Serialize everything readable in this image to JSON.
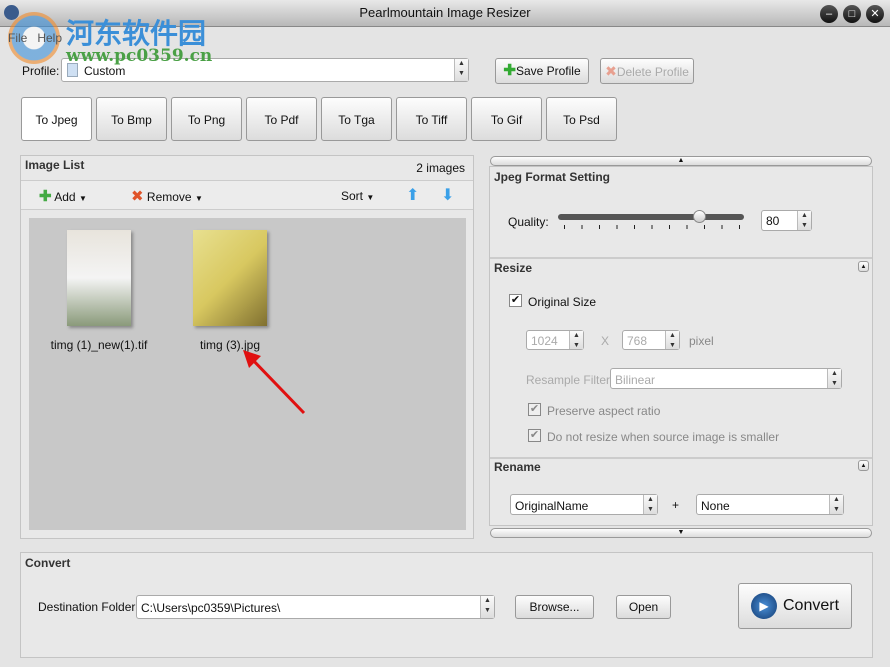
{
  "window": {
    "title": "Pearlmountain Image Resizer",
    "minimize": "–",
    "maximize": "□",
    "close": "✕"
  },
  "menu": [
    "File",
    "Help"
  ],
  "watermark": {
    "name": "河东软件园",
    "url": "www.pc0359.cn"
  },
  "profile": {
    "label": "Profile:",
    "value": "Custom",
    "save": "Save Profile",
    "delete": "Delete Profile"
  },
  "tabs": [
    "To Jpeg",
    "To Bmp",
    "To Png",
    "To Pdf",
    "To Tga",
    "To Tiff",
    "To Gif",
    "To Psd"
  ],
  "image_list": {
    "title": "Image List",
    "count": "2 images",
    "add": "Add",
    "remove": "Remove",
    "sort": "Sort",
    "images": [
      {
        "name": "timg (1)_new(1).tif"
      },
      {
        "name": "timg (3).jpg"
      }
    ]
  },
  "jpeg": {
    "title": "Jpeg Format Setting",
    "quality_label": "Quality:",
    "quality": "80",
    "quality_max": 100
  },
  "resize": {
    "title": "Resize",
    "original_size": "Original Size",
    "original_checked": true,
    "width": "1024",
    "x": "X",
    "height": "768",
    "unit": "pixel",
    "filter_label": "Resample Filter:",
    "filter": "Bilinear",
    "aspect": "Preserve aspect ratio",
    "no_enlarge": "Do not resize when source image is smaller"
  },
  "rename": {
    "title": "Rename",
    "name": "OriginalName",
    "plus": "+",
    "suffix": "None"
  },
  "convert": {
    "title": "Convert",
    "dest_label": "Destination Folder:",
    "dest": "C:\\Users\\pc0359\\Pictures\\",
    "browse": "Browse...",
    "open": "Open",
    "convert": "Convert"
  },
  "colors": {
    "accent": "#2a7fd4",
    "titlebar": "#c8c8c8"
  }
}
